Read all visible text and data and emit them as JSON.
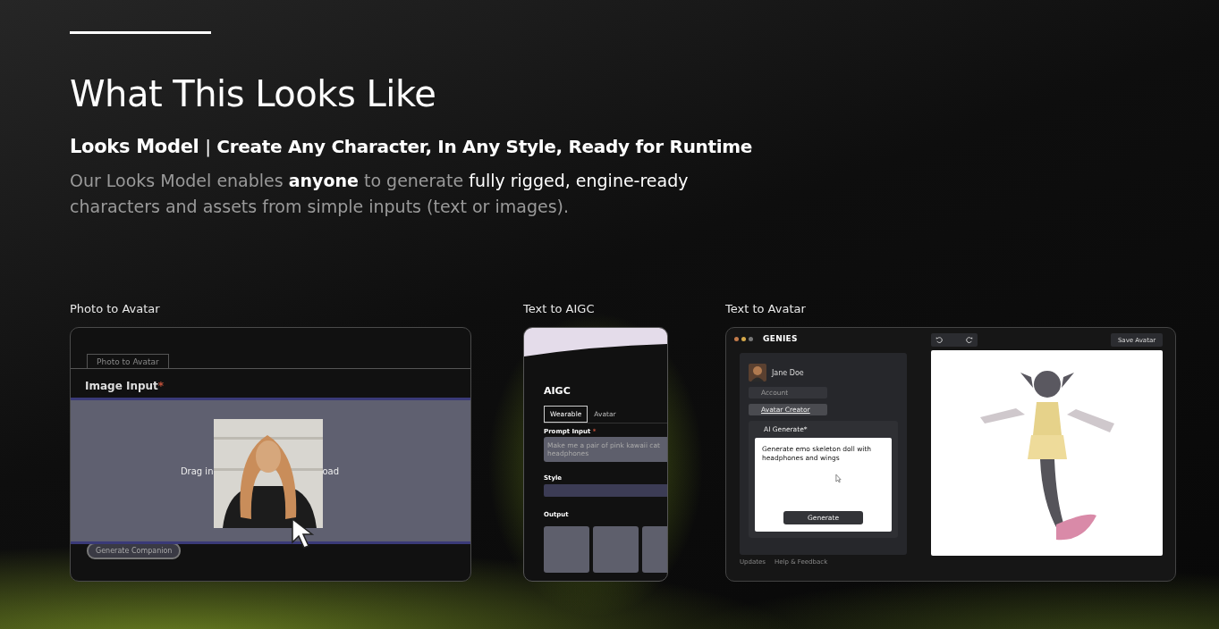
{
  "heading": "What This Looks Like",
  "subtitle": {
    "lead": "Looks Model",
    "separator": "|",
    "rest": "Create Any Character, In Any Style, Ready for Runtime"
  },
  "description": [
    {
      "text": "Our Looks Model enables ",
      "highlighted": false,
      "bold": false
    },
    {
      "text": "anyone",
      "highlighted": true,
      "bold": true
    },
    {
      "text": " to generate ",
      "highlighted": false,
      "bold": false
    },
    {
      "text": "fully rigged, engine-ready",
      "highlighted": true,
      "bold": false
    },
    {
      "text": " characters and assets from simple inputs (text or images).",
      "highlighted": false,
      "bold": false
    }
  ],
  "demos": [
    {
      "caption": "Photo to Avatar",
      "tab": "Photo to Avatar",
      "input_label": "Image Input",
      "required_mark": "*",
      "drop_text_start": "Drag in",
      "drop_text_end": "oad",
      "button": "Generate Companion"
    },
    {
      "kind": "aigc",
      "caption": "Text to AIGC",
      "title": "AIGC",
      "tabs": [
        {
          "label": "Wearable",
          "selected": true
        },
        {
          "label": "Avatar",
          "selected": false
        }
      ],
      "prompt_label": "Prompt Input",
      "required_mark": "*",
      "prompt_placeholder": "Make me a pair of pink kawaii cat headphones",
      "style_label": "Style",
      "output_label": "Output"
    },
    {
      "kind": "avatar",
      "caption": "Text to Avatar",
      "logo": "GENIES",
      "user": "Jane Doe",
      "menu": [
        {
          "label": "Account",
          "selected": false
        },
        {
          "label": "Avatar Creator",
          "selected": true
        }
      ],
      "panel_title": "AI Generate*",
      "prompt": "Generate emo skeleton doll with headphones and wings",
      "generate": "Generate",
      "links": [
        "Updates",
        "Help & Feedback"
      ],
      "save": "Save Avatar"
    }
  ]
}
